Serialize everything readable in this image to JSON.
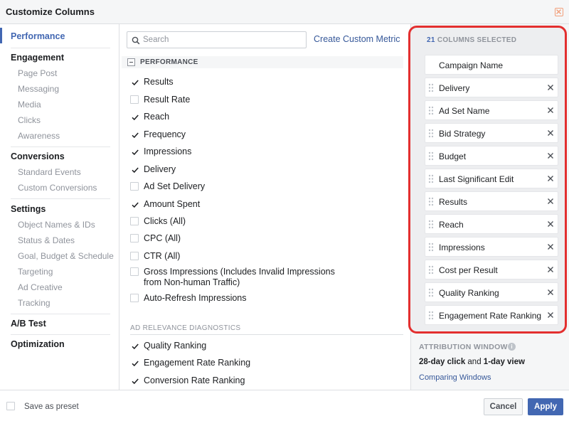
{
  "window": {
    "title": "Customize Columns",
    "close_icon": "close-icon"
  },
  "sidebar": {
    "active": "Performance",
    "groups": [
      {
        "heading": "Performance",
        "items": []
      },
      {
        "heading": "Engagement",
        "items": [
          "Page Post",
          "Messaging",
          "Media",
          "Clicks",
          "Awareness"
        ]
      },
      {
        "heading": "Conversions",
        "items": [
          "Standard Events",
          "Custom Conversions"
        ]
      },
      {
        "heading": "Settings",
        "items": [
          "Object Names & IDs",
          "Status & Dates",
          "Goal, Budget & Schedule",
          "Targeting",
          "Ad Creative",
          "Tracking"
        ]
      },
      {
        "heading": "A/B Test",
        "items": []
      },
      {
        "heading": "Optimization",
        "items": []
      }
    ]
  },
  "search": {
    "placeholder": "Search",
    "value": ""
  },
  "create_custom_metric": "Create Custom Metric",
  "performance": {
    "section_label": "PERFORMANCE",
    "metrics": [
      {
        "label": "Results",
        "checked": true
      },
      {
        "label": "Result Rate",
        "checked": false
      },
      {
        "label": "Reach",
        "checked": true
      },
      {
        "label": "Frequency",
        "checked": true
      },
      {
        "label": "Impressions",
        "checked": true
      },
      {
        "label": "Delivery",
        "checked": true
      },
      {
        "label": "Ad Set Delivery",
        "checked": false
      },
      {
        "label": "Amount Spent",
        "checked": true
      },
      {
        "label": "Clicks (All)",
        "checked": false
      },
      {
        "label": "CPC (All)",
        "checked": false
      },
      {
        "label": "CTR (All)",
        "checked": false
      },
      {
        "label": "Gross Impressions (Includes Invalid Impressions",
        "label_line2": "from Non-human Traffic)",
        "checked": false
      },
      {
        "label": "Auto-Refresh Impressions",
        "checked": false
      }
    ]
  },
  "ad_relevance": {
    "section_label": "AD RELEVANCE DIAGNOSTICS",
    "metrics": [
      {
        "label": "Quality Ranking",
        "checked": true
      },
      {
        "label": "Engagement Rate Ranking",
        "checked": true
      },
      {
        "label": "Conversion Rate Ranking",
        "checked": true
      }
    ]
  },
  "selected": {
    "count": "21",
    "count_suffix": "COLUMNS SELECTED",
    "columns": [
      {
        "name": "Campaign Name",
        "removable": false
      },
      {
        "name": "Delivery",
        "removable": true
      },
      {
        "name": "Ad Set Name",
        "removable": true
      },
      {
        "name": "Bid Strategy",
        "removable": true
      },
      {
        "name": "Budget",
        "removable": true
      },
      {
        "name": "Last Significant Edit",
        "removable": true
      },
      {
        "name": "Results",
        "removable": true
      },
      {
        "name": "Reach",
        "removable": true
      },
      {
        "name": "Impressions",
        "removable": true
      },
      {
        "name": "Cost per Result",
        "removable": true
      },
      {
        "name": "Quality Ranking",
        "removable": true
      },
      {
        "name": "Engagement Rate Ranking",
        "removable": true
      }
    ]
  },
  "attribution": {
    "heading": "ATTRIBUTION WINDOW",
    "click": "28-day click",
    "joiner": " and ",
    "view": "1-day view",
    "link": "Comparing Windows"
  },
  "footer": {
    "save_preset": "Save as preset",
    "cancel": "Cancel",
    "apply": "Apply"
  },
  "colors": {
    "accent": "#4267b2",
    "link": "#365899",
    "highlight": "#e32f2f"
  }
}
